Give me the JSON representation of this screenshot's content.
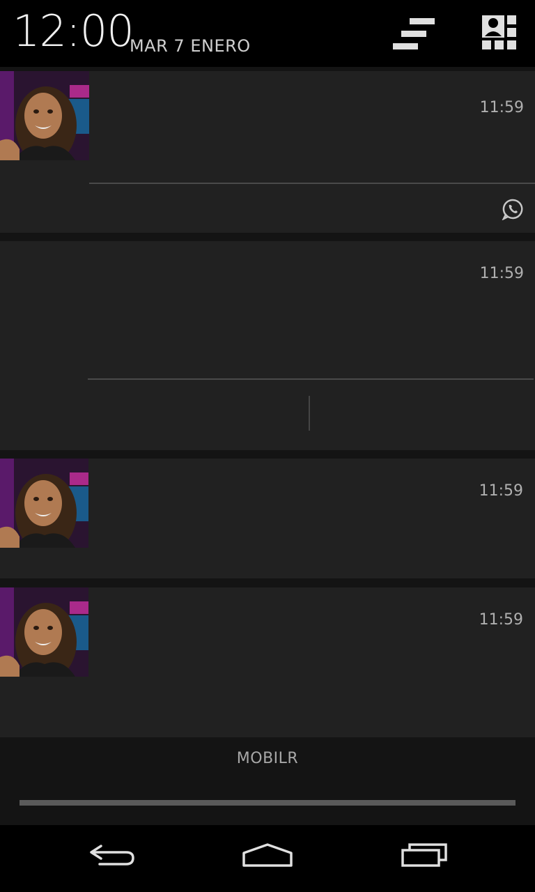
{
  "status": {
    "time": "12:00",
    "date": "MAR 7 ENERO"
  },
  "header": {
    "clear_icon": "clear-all-icon",
    "quick_settings_icon": "quick-settings-icon"
  },
  "notifications": [
    {
      "time": "11:59",
      "app_icon": "whatsapp-icon",
      "has_avatar": true
    },
    {
      "time": "11:59",
      "has_avatar": false
    },
    {
      "time": "11:59",
      "has_avatar": true
    },
    {
      "time": "11:59",
      "has_avatar": true
    }
  ],
  "footer": {
    "label": "MOBILR"
  },
  "navbar": {
    "back_icon": "back-icon",
    "home_icon": "home-icon",
    "recents_icon": "recents-icon"
  },
  "colors": {
    "background": "#000000",
    "card": "#212121",
    "panel": "#141414",
    "text": "#b0b0b0"
  }
}
